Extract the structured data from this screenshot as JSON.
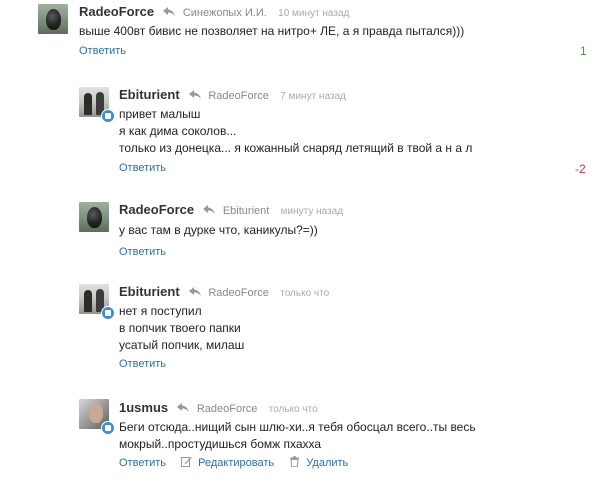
{
  "comments": [
    {
      "author": "RadeoForce",
      "reply_to": "Синежопых И.И.",
      "time": "10 минут назад",
      "lines": [
        "выше 400вт бивис не позволяет на нитро+ ЛЕ, а я правда пытался)))"
      ],
      "reply_label": "Ответить",
      "score": "1",
      "avatar": "moto-helmet-avatar",
      "badge": false
    },
    {
      "author": "Ebiturient",
      "reply_to": "RadeoForce",
      "time": "7 минут назад",
      "lines": [
        "привет малыш",
        "я как дима соколов...",
        "только из донецка... я кожанный снаряд летящий в твой а н а л"
      ],
      "reply_label": "Ответить",
      "score": "-2",
      "avatar": "two-people-avatar",
      "badge": true
    },
    {
      "author": "RadeoForce",
      "reply_to": "Ebiturient",
      "time": "минуту назад",
      "lines": [
        "у вас там в дурке что, каникулы?=))"
      ],
      "reply_label": "Ответить",
      "avatar": "moto-helmet-avatar",
      "badge": false
    },
    {
      "author": "Ebiturient",
      "reply_to": "RadeoForce",
      "time": "только что",
      "lines": [
        "нет я поступил",
        "в попчик твоего папки",
        "усатый попчик, милаш"
      ],
      "reply_label": "Ответить",
      "avatar": "two-people-avatar",
      "badge": true
    },
    {
      "author": "1usmus",
      "reply_to": "RadeoForce",
      "time": "только что",
      "lines": [
        "Беги отсюда..нищий сын шлю-хи..я тебя обосцал всего..ты весь",
        "мокрый..простудишься бомж пхахха"
      ],
      "reply_label": "Ответить",
      "edit_label": "Редактировать",
      "delete_label": "Удалить",
      "avatar": "face-avatar",
      "badge": true
    }
  ],
  "colors": {
    "link": "#2a6fb0",
    "positive": "#3aa23a",
    "negative": "#dd3333",
    "badge": "#3a8fd6"
  }
}
